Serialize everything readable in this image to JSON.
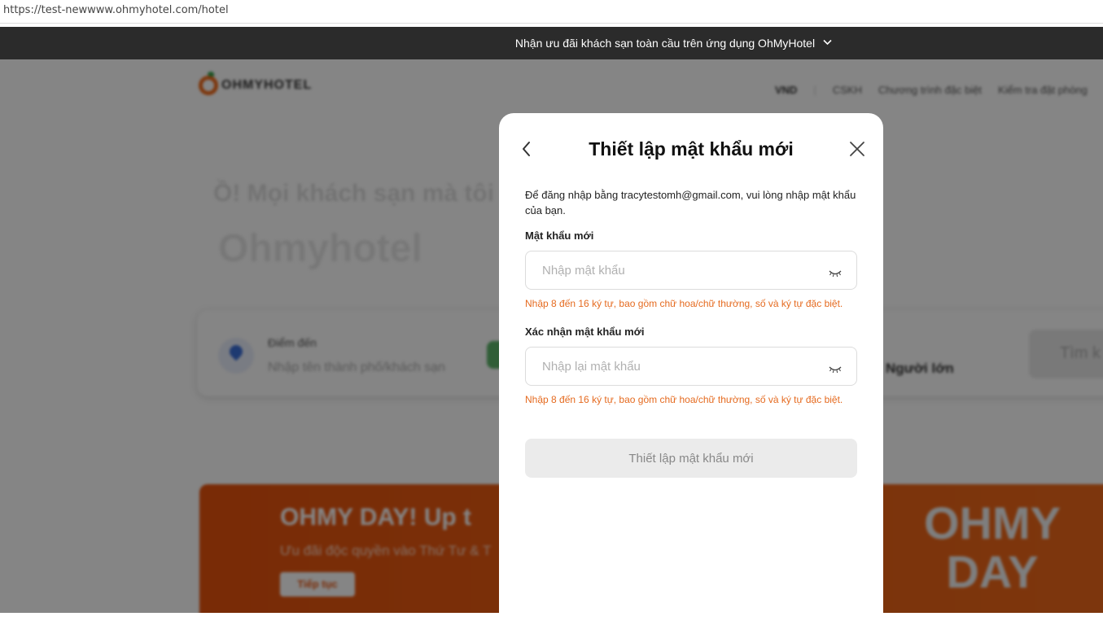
{
  "browser": {
    "url": "https://test-newwww.ohmyhotel.com/hotel"
  },
  "promo": {
    "text": "Nhận ưu đãi khách sạn toàn cầu trên ứng dụng OhMyHotel",
    "chevron": "⌄"
  },
  "header": {
    "logo": "OHMYHOTEL",
    "nav": [
      "VND",
      "CSKH",
      "Chương trình đặc biệt",
      "Kiểm tra đặt phòng"
    ]
  },
  "hero": {
    "subtitle": "Ồ! Mọi khách sạn mà tôi",
    "brand": "Ohmyhotel"
  },
  "search": {
    "destination_label": "Điểm đến",
    "destination_placeholder": "Nhập tên thành phố/khách sạn",
    "guests": "Người lớn",
    "button": "Tìm k"
  },
  "banner": {
    "title": "OHMY DAY! Up t",
    "subtitle": "Ưu đãi độc quyền vào Thứ Tư & T",
    "button": "Tiếp tục",
    "logo_line1": "OHMY",
    "logo_line2": "DAY"
  },
  "modal": {
    "title": "Thiết lập mật khẩu mới",
    "description": "Để đăng nhập bằng tracytestomh@gmail.com, vui lòng nhập mật khẩu của bạn.",
    "new_password": {
      "label": "Mật khẩu mới",
      "placeholder": "Nhập mật khẩu",
      "hint": "Nhập 8 đến 16 ký tự, bao gồm chữ hoa/chữ thường, số và ký tự đặc biệt."
    },
    "confirm_password": {
      "label": "Xác nhận mật khẩu mới",
      "placeholder": "Nhập lại mật khẩu",
      "hint": "Nhập 8 đến 16 ký tự, bao gồm chữ hoa/chữ thường, số và ký tự đặc biệt."
    },
    "submit_label": "Thiết lập mật khẩu mới"
  },
  "icons": {
    "back": "chevron-left-icon",
    "close": "close-icon",
    "eye": "eye-closed-icon",
    "location": "location-pin-icon"
  },
  "colors": {
    "accent": "#f06a1a",
    "hint": "#e56a1f",
    "promo_bg": "#2b2b2b",
    "disabled_button": "#ebebeb"
  }
}
